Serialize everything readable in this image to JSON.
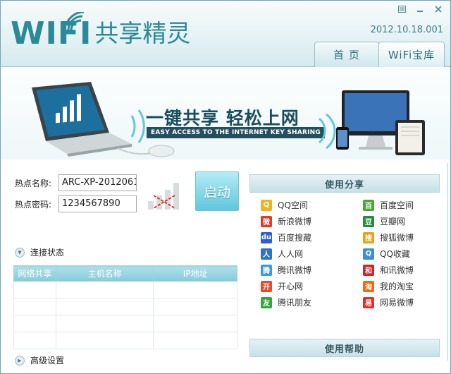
{
  "app": {
    "logo_wifi": "WIFI",
    "logo_cn": "共享精灵",
    "version": "2012.10.18.001",
    "accent_color": "#2b8a96"
  },
  "window_controls": {
    "menu_icon": "menu-icon",
    "minimize_icon": "minimize-icon",
    "close_icon": "close-icon"
  },
  "tabs": [
    {
      "label": "首  页"
    },
    {
      "label": "WiFi宝库"
    }
  ],
  "banner": {
    "title": "一键共享 轻松上网",
    "subtitle": "EASY ACCESS TO THE INTERNET KEY SHARING"
  },
  "hotspot": {
    "name_label": "热点名称:",
    "name_value": "ARC-XP-2012061",
    "password_label": "热点密码:",
    "password_value": "1234567890",
    "start_label": "启动"
  },
  "connection": {
    "title": "连接状态",
    "columns": [
      "网络共享",
      "主机名称",
      "IP地址"
    ],
    "rows": [
      [
        "",
        "",
        ""
      ],
      [
        "",
        "",
        ""
      ],
      [
        "",
        "",
        ""
      ],
      [
        "",
        "",
        ""
      ]
    ]
  },
  "advanced": {
    "title": "高级设置"
  },
  "share": {
    "title": "使用分享",
    "items": [
      {
        "label": "QQ空间",
        "icon": "qzone-icon",
        "color": "#f2b21f"
      },
      {
        "label": "百度空间",
        "icon": "baidu-space-icon",
        "color": "#4fa43a"
      },
      {
        "label": "新浪微博",
        "icon": "sina-weibo-icon",
        "color": "#e23b2e"
      },
      {
        "label": "豆瓣网",
        "icon": "douban-icon",
        "color": "#2a8a3e"
      },
      {
        "label": "百度搜藏",
        "icon": "baidu-icon",
        "color": "#2d5fd3"
      },
      {
        "label": "搜狐微博",
        "icon": "sohu-weibo-icon",
        "color": "#e8a21a"
      },
      {
        "label": "人人网",
        "icon": "renren-icon",
        "color": "#2f74c6"
      },
      {
        "label": "QQ收藏",
        "icon": "qq-favorite-icon",
        "color": "#3b8fd8"
      },
      {
        "label": "腾讯微博",
        "icon": "tencent-weibo-icon",
        "color": "#3a9bd6"
      },
      {
        "label": "和讯微博",
        "icon": "hexun-weibo-icon",
        "color": "#c8282b"
      },
      {
        "label": "开心网",
        "icon": "kaixin-icon",
        "color": "#e84a2a"
      },
      {
        "label": "我的淘宝",
        "icon": "taobao-icon",
        "color": "#f06a14"
      },
      {
        "label": "腾讯朋友",
        "icon": "tencent-friend-icon",
        "color": "#37a53c"
      },
      {
        "label": "网易微博",
        "icon": "netease-weibo-icon",
        "color": "#d9342b"
      }
    ]
  },
  "help": {
    "title": "使用帮助"
  }
}
